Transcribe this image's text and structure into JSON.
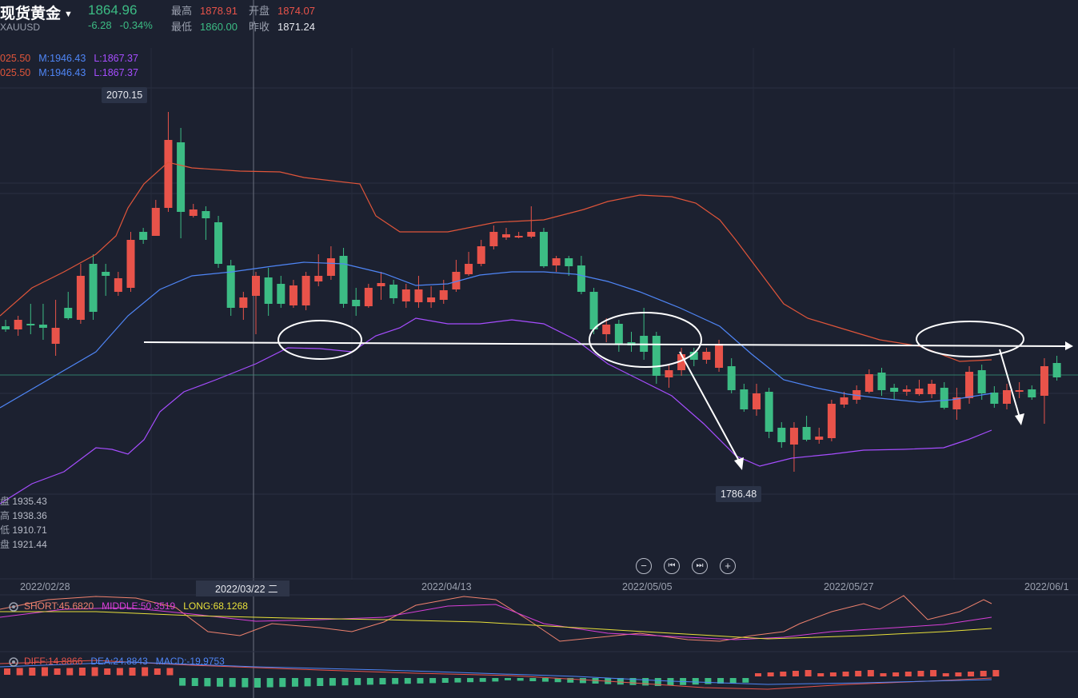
{
  "header": {
    "title": "现货黄金",
    "symbol": "XAUUSD",
    "price": "1864.96",
    "change": "-6.28",
    "change_pct": "-0.34%",
    "high_label": "最高",
    "high": "1878.91",
    "open_label": "开盘",
    "open": "1874.07",
    "low_label": "最低",
    "low": "1860.00",
    "prev_label": "昨收",
    "prev": "1871.24"
  },
  "boll": {
    "line1": {
      "u": "025.50",
      "m": "M:1946.43",
      "l": "L:1867.37"
    },
    "line2": {
      "u": "025.50",
      "m": "M:1946.43",
      "l": "L:1867.37"
    }
  },
  "annotations": {
    "high_tip": "2070.15",
    "low_tip": "1786.48"
  },
  "stats": [
    {
      "k": "盘",
      "v": "1935.43"
    },
    {
      "k": "高",
      "v": "1938.36"
    },
    {
      "k": "低",
      "v": "1910.71"
    },
    {
      "k": "盘",
      "v": "1921.44"
    }
  ],
  "dates": {
    "d1": "2022/02/28",
    "d2": "2022/03/22 二",
    "d3": "2022/04/13",
    "d4": "2022/05/05",
    "d5": "2022/05/27",
    "d6": "2022/06/1"
  },
  "controls": {
    "zoom_out": "−",
    "prev": "⏮",
    "next": "⏭",
    "zoom_in": "+"
  },
  "indicators": {
    "short": "SHORT:45.6820",
    "middle": "MIDDLE:50.3519",
    "long": "LONG:68.1268",
    "diff": "DIFF:14.8866",
    "dea": "DEA:24.8843",
    "macd": "MACD:-19.9753"
  },
  "colors": {
    "up": "#e8534a",
    "down": "#3cbc84",
    "bg": "#1c2130",
    "upper": "#e0553a",
    "mid": "#4f86f7",
    "lower": "#a64dff"
  }
}
